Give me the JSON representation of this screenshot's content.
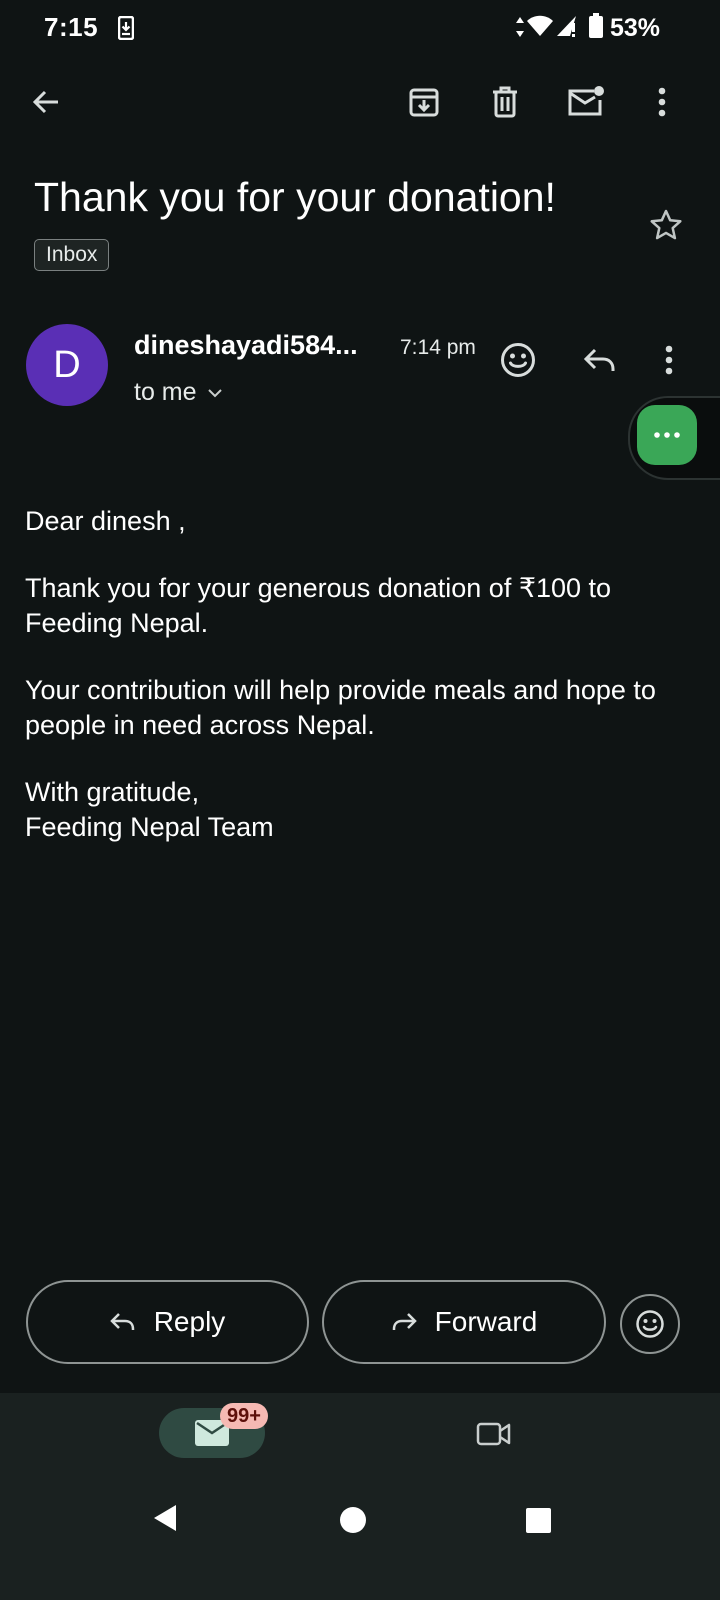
{
  "status_bar": {
    "time": "7:15",
    "battery": "53%"
  },
  "toolbar": {
    "back_icon": "arrow-left-icon",
    "archive_icon": "archive-icon",
    "delete_icon": "trash-icon",
    "unread_icon": "mark-unread-icon",
    "more_icon": "more-vert-icon"
  },
  "email": {
    "subject": "Thank you for your donation!",
    "label": "Inbox",
    "sender_initial": "D",
    "sender": "dineshayadi584...",
    "time": "7:14 pm",
    "recipient": "to me",
    "body": [
      "Dear dinesh ,",
      "Thank you for your generous donation of ₹100 to Feeding Nepal.",
      "Your contribution will help provide meals and hope to people in need across Nepal."
    ],
    "closing_line1": "With gratitude,",
    "closing_line2": "Feeding Nepal Team"
  },
  "actions": {
    "reply_label": "Reply",
    "forward_label": "Forward"
  },
  "bottom_nav": {
    "mail_badge": "99+"
  },
  "colors": {
    "background": "#0f1414",
    "avatar": "#5a2fb5",
    "chat_bubble": "#3aa757",
    "nav_active": "#2f4a42",
    "badge": "#f6b9b3"
  }
}
